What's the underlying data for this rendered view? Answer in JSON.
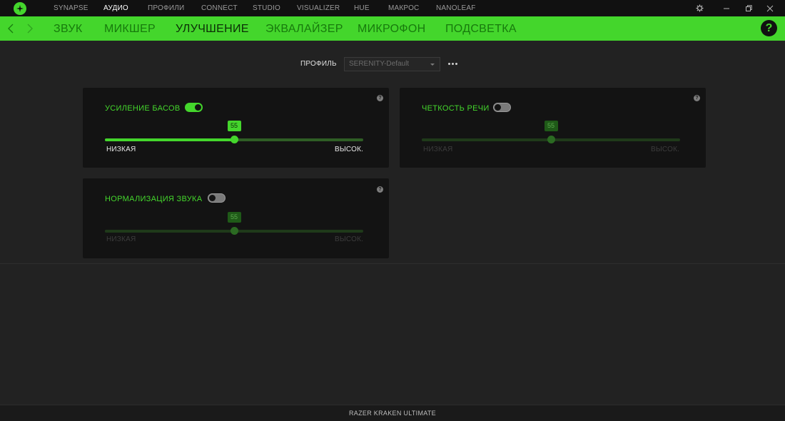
{
  "app": {
    "top_nav": [
      "SYNAPSE",
      "АУДИО",
      "ПРОФИЛИ",
      "CONNECT",
      "STUDIO",
      "VISUALIZER",
      "HUE",
      "МАКРОС",
      "NANOLEAF"
    ],
    "active_top": "АУДИО",
    "sub_tabs": [
      "ЗВУК",
      "МИКШЕР",
      "УЛУЧШЕНИЕ",
      "ЭКВАЛАЙЗЕР",
      "МИКРОФОН",
      "ПОДСВЕТКА"
    ],
    "active_sub": "УЛУЧШЕНИЕ",
    "help_label": "?",
    "accent_color": "#44d62c"
  },
  "profile": {
    "label": "ПРОФИЛЬ",
    "selected": "SERENITY-Default"
  },
  "panels": {
    "bass": {
      "title": "УСИЛЕНИЕ БАСОВ",
      "enabled": true,
      "value": "55",
      "level": 0.5,
      "low": "НИЗКАЯ",
      "high": "ВЫСОК."
    },
    "speech": {
      "title": "ЧЕТКОСТЬ РЕЧИ",
      "enabled": false,
      "value": "55",
      "level": 0.5,
      "low": "НИЗКАЯ",
      "high": "ВЫСОК."
    },
    "norm": {
      "title": "НОРМАЛИЗАЦИЯ ЗВУКА",
      "enabled": false,
      "value": "55",
      "level": 0.5,
      "low": "НИЗКАЯ",
      "high": "ВЫСОК."
    }
  },
  "help_icon_label": "?",
  "footer": {
    "device": "RAZER KRAKEN ULTIMATE"
  }
}
